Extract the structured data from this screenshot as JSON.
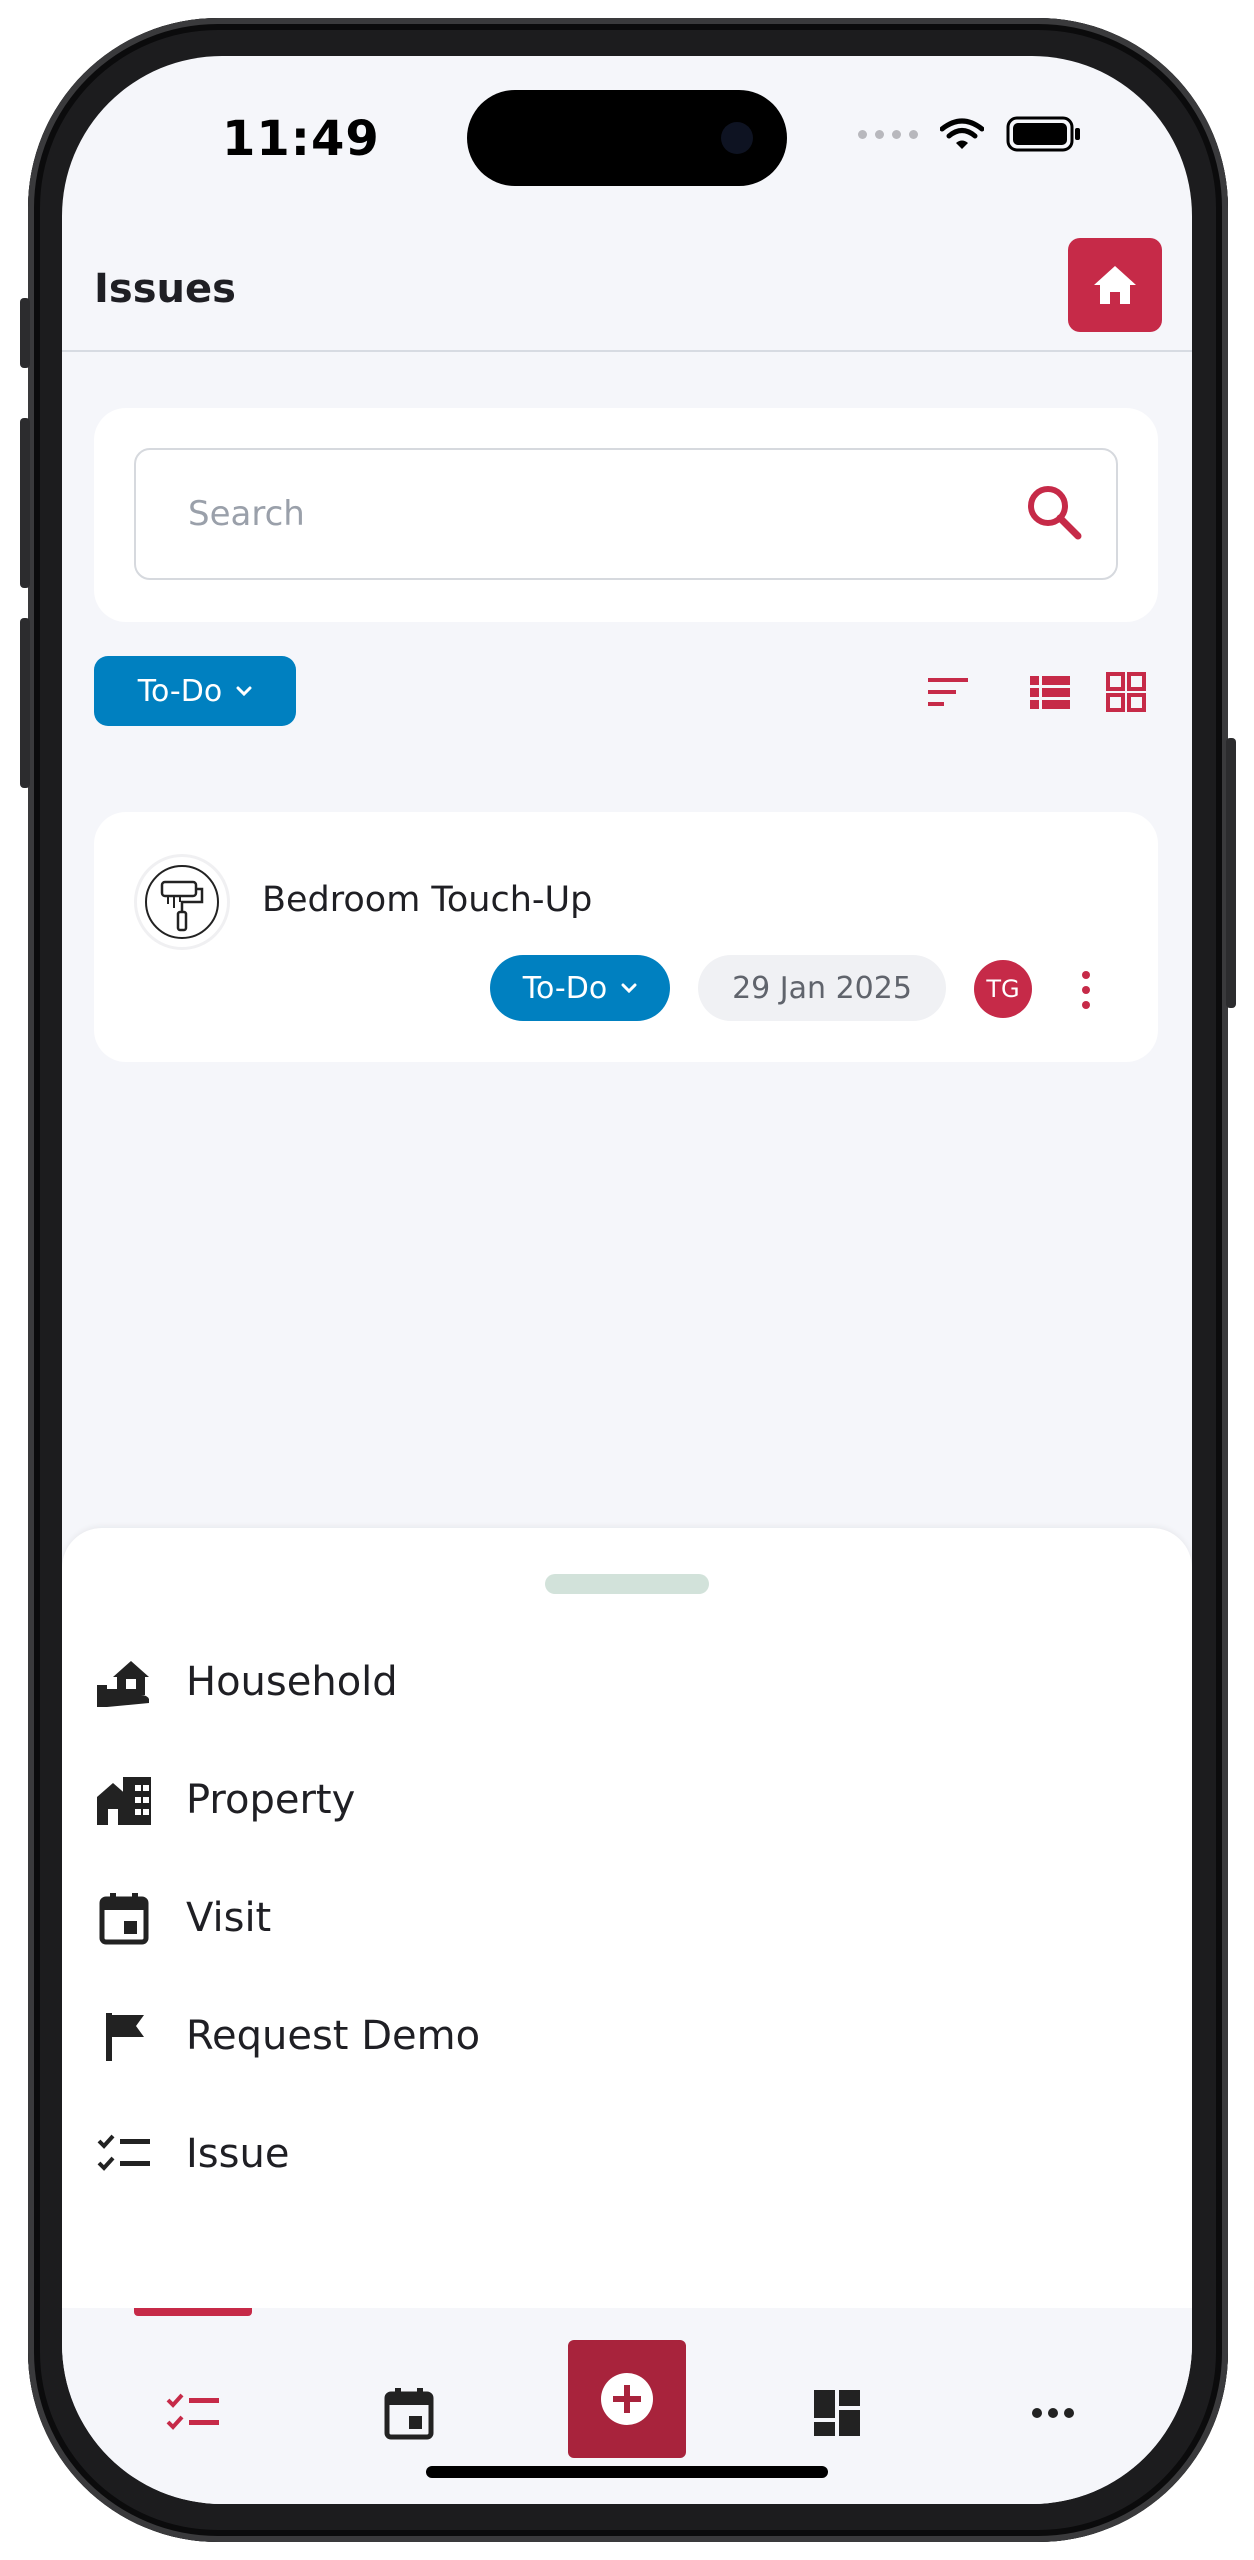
{
  "status_bar": {
    "time": "11:49"
  },
  "header": {
    "title": "Issues"
  },
  "search": {
    "placeholder": "Search"
  },
  "filter": {
    "selected": "To-Do"
  },
  "issues": [
    {
      "title": "Bedroom Touch-Up",
      "status": "To-Do",
      "date": "29 Jan 2025",
      "assignee_initials": "TG"
    }
  ],
  "sheet_menu": [
    {
      "label": "Household",
      "icon": "household-icon"
    },
    {
      "label": "Property",
      "icon": "property-icon"
    },
    {
      "label": "Visit",
      "icon": "calendar-icon"
    },
    {
      "label": "Request Demo",
      "icon": "flag-icon"
    },
    {
      "label": "Issue",
      "icon": "checklist-icon"
    }
  ],
  "tabbar": {
    "tabs": [
      "issues-tab",
      "calendar-tab",
      "add-tab",
      "dashboard-tab",
      "more-tab"
    ],
    "active": "issues-tab"
  },
  "colors": {
    "brand_red": "#c62a48",
    "status_blue": "#0080c0",
    "background": "#f5f6fa"
  }
}
